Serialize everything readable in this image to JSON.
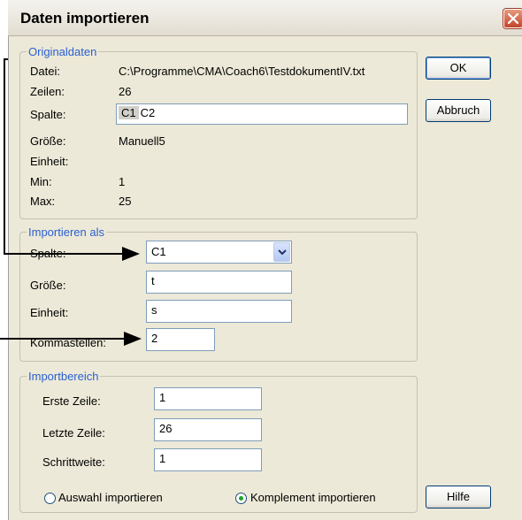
{
  "dialog": {
    "title": "Daten importieren",
    "close_icon": "close-icon"
  },
  "original": {
    "legend": "Originaldaten",
    "datei_label": "Datei:",
    "datei_value": "C:\\Programme\\CMA\\Coach6\\TestdokumentIV.txt",
    "zeilen_label": "Zeilen:",
    "zeilen_value": "26",
    "spalte_label": "Spalte:",
    "spalte_selected": "C1",
    "spalte_other": "C2",
    "groesse_label": "Größe:",
    "groesse_value": "Manuell5",
    "einheit_label": "Einheit:",
    "einheit_value": "",
    "min_label": "Min:",
    "min_value": "1",
    "max_label": "Max:",
    "max_value": "25"
  },
  "import_as": {
    "legend": "Importieren als",
    "spalte_label": "Spalte:",
    "spalte_value": "C1",
    "groesse_label": "Größe:",
    "groesse_value": "t",
    "einheit_label": "Einheit:",
    "einheit_value": "s",
    "kommastellen_label": "Kommastellen:",
    "kommastellen_value": "2"
  },
  "range": {
    "legend": "Importbereich",
    "erste_label": "Erste Zeile:",
    "erste_value": "1",
    "letzte_label": "Letzte Zeile:",
    "letzte_value": "26",
    "schritt_label": "Schrittweite:",
    "schritt_value": "1",
    "radio_auswahl": "Auswahl importieren",
    "radio_komplement": "Komplement importieren",
    "selected_radio": "komplement"
  },
  "buttons": {
    "ok": "OK",
    "abbruch": "Abbruch",
    "hilfe": "Hilfe"
  }
}
